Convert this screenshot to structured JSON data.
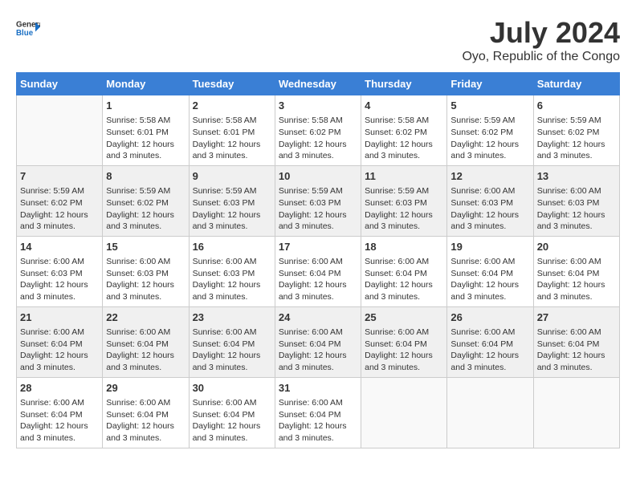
{
  "header": {
    "logo_text_general": "General",
    "logo_text_blue": "Blue",
    "month_year": "July 2024",
    "location": "Oyo, Republic of the Congo"
  },
  "days_of_week": [
    "Sunday",
    "Monday",
    "Tuesday",
    "Wednesday",
    "Thursday",
    "Friday",
    "Saturday"
  ],
  "weeks": [
    [
      {
        "day": "",
        "sunrise": "",
        "sunset": "",
        "daylight": ""
      },
      {
        "day": "1",
        "sunrise": "Sunrise: 5:58 AM",
        "sunset": "Sunset: 6:01 PM",
        "daylight": "Daylight: 12 hours and 3 minutes."
      },
      {
        "day": "2",
        "sunrise": "Sunrise: 5:58 AM",
        "sunset": "Sunset: 6:01 PM",
        "daylight": "Daylight: 12 hours and 3 minutes."
      },
      {
        "day": "3",
        "sunrise": "Sunrise: 5:58 AM",
        "sunset": "Sunset: 6:02 PM",
        "daylight": "Daylight: 12 hours and 3 minutes."
      },
      {
        "day": "4",
        "sunrise": "Sunrise: 5:58 AM",
        "sunset": "Sunset: 6:02 PM",
        "daylight": "Daylight: 12 hours and 3 minutes."
      },
      {
        "day": "5",
        "sunrise": "Sunrise: 5:59 AM",
        "sunset": "Sunset: 6:02 PM",
        "daylight": "Daylight: 12 hours and 3 minutes."
      },
      {
        "day": "6",
        "sunrise": "Sunrise: 5:59 AM",
        "sunset": "Sunset: 6:02 PM",
        "daylight": "Daylight: 12 hours and 3 minutes."
      }
    ],
    [
      {
        "day": "7",
        "sunrise": "Sunrise: 5:59 AM",
        "sunset": "Sunset: 6:02 PM",
        "daylight": "Daylight: 12 hours and 3 minutes."
      },
      {
        "day": "8",
        "sunrise": "Sunrise: 5:59 AM",
        "sunset": "Sunset: 6:02 PM",
        "daylight": "Daylight: 12 hours and 3 minutes."
      },
      {
        "day": "9",
        "sunrise": "Sunrise: 5:59 AM",
        "sunset": "Sunset: 6:03 PM",
        "daylight": "Daylight: 12 hours and 3 minutes."
      },
      {
        "day": "10",
        "sunrise": "Sunrise: 5:59 AM",
        "sunset": "Sunset: 6:03 PM",
        "daylight": "Daylight: 12 hours and 3 minutes."
      },
      {
        "day": "11",
        "sunrise": "Sunrise: 5:59 AM",
        "sunset": "Sunset: 6:03 PM",
        "daylight": "Daylight: 12 hours and 3 minutes."
      },
      {
        "day": "12",
        "sunrise": "Sunrise: 6:00 AM",
        "sunset": "Sunset: 6:03 PM",
        "daylight": "Daylight: 12 hours and 3 minutes."
      },
      {
        "day": "13",
        "sunrise": "Sunrise: 6:00 AM",
        "sunset": "Sunset: 6:03 PM",
        "daylight": "Daylight: 12 hours and 3 minutes."
      }
    ],
    [
      {
        "day": "14",
        "sunrise": "Sunrise: 6:00 AM",
        "sunset": "Sunset: 6:03 PM",
        "daylight": "Daylight: 12 hours and 3 minutes."
      },
      {
        "day": "15",
        "sunrise": "Sunrise: 6:00 AM",
        "sunset": "Sunset: 6:03 PM",
        "daylight": "Daylight: 12 hours and 3 minutes."
      },
      {
        "day": "16",
        "sunrise": "Sunrise: 6:00 AM",
        "sunset": "Sunset: 6:03 PM",
        "daylight": "Daylight: 12 hours and 3 minutes."
      },
      {
        "day": "17",
        "sunrise": "Sunrise: 6:00 AM",
        "sunset": "Sunset: 6:04 PM",
        "daylight": "Daylight: 12 hours and 3 minutes."
      },
      {
        "day": "18",
        "sunrise": "Sunrise: 6:00 AM",
        "sunset": "Sunset: 6:04 PM",
        "daylight": "Daylight: 12 hours and 3 minutes."
      },
      {
        "day": "19",
        "sunrise": "Sunrise: 6:00 AM",
        "sunset": "Sunset: 6:04 PM",
        "daylight": "Daylight: 12 hours and 3 minutes."
      },
      {
        "day": "20",
        "sunrise": "Sunrise: 6:00 AM",
        "sunset": "Sunset: 6:04 PM",
        "daylight": "Daylight: 12 hours and 3 minutes."
      }
    ],
    [
      {
        "day": "21",
        "sunrise": "Sunrise: 6:00 AM",
        "sunset": "Sunset: 6:04 PM",
        "daylight": "Daylight: 12 hours and 3 minutes."
      },
      {
        "day": "22",
        "sunrise": "Sunrise: 6:00 AM",
        "sunset": "Sunset: 6:04 PM",
        "daylight": "Daylight: 12 hours and 3 minutes."
      },
      {
        "day": "23",
        "sunrise": "Sunrise: 6:00 AM",
        "sunset": "Sunset: 6:04 PM",
        "daylight": "Daylight: 12 hours and 3 minutes."
      },
      {
        "day": "24",
        "sunrise": "Sunrise: 6:00 AM",
        "sunset": "Sunset: 6:04 PM",
        "daylight": "Daylight: 12 hours and 3 minutes."
      },
      {
        "day": "25",
        "sunrise": "Sunrise: 6:00 AM",
        "sunset": "Sunset: 6:04 PM",
        "daylight": "Daylight: 12 hours and 3 minutes."
      },
      {
        "day": "26",
        "sunrise": "Sunrise: 6:00 AM",
        "sunset": "Sunset: 6:04 PM",
        "daylight": "Daylight: 12 hours and 3 minutes."
      },
      {
        "day": "27",
        "sunrise": "Sunrise: 6:00 AM",
        "sunset": "Sunset: 6:04 PM",
        "daylight": "Daylight: 12 hours and 3 minutes."
      }
    ],
    [
      {
        "day": "28",
        "sunrise": "Sunrise: 6:00 AM",
        "sunset": "Sunset: 6:04 PM",
        "daylight": "Daylight: 12 hours and 3 minutes."
      },
      {
        "day": "29",
        "sunrise": "Sunrise: 6:00 AM",
        "sunset": "Sunset: 6:04 PM",
        "daylight": "Daylight: 12 hours and 3 minutes."
      },
      {
        "day": "30",
        "sunrise": "Sunrise: 6:00 AM",
        "sunset": "Sunset: 6:04 PM",
        "daylight": "Daylight: 12 hours and 3 minutes."
      },
      {
        "day": "31",
        "sunrise": "Sunrise: 6:00 AM",
        "sunset": "Sunset: 6:04 PM",
        "daylight": "Daylight: 12 hours and 3 minutes."
      },
      {
        "day": "",
        "sunrise": "",
        "sunset": "",
        "daylight": ""
      },
      {
        "day": "",
        "sunrise": "",
        "sunset": "",
        "daylight": ""
      },
      {
        "day": "",
        "sunrise": "",
        "sunset": "",
        "daylight": ""
      }
    ]
  ]
}
